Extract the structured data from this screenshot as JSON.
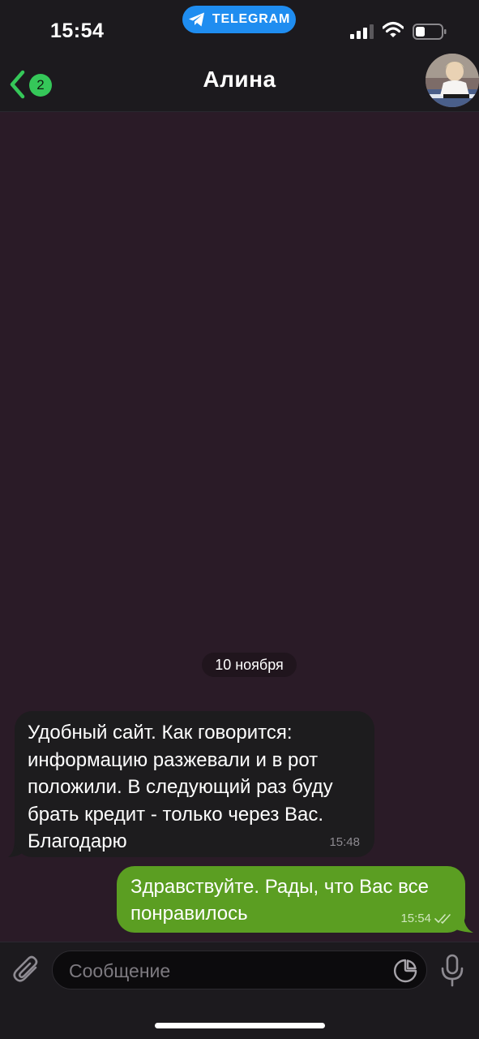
{
  "status_bar": {
    "time": "15:54",
    "app_label": "TELEGRAM",
    "app_color": "#1f8df0"
  },
  "header": {
    "back_icon": "chevron-left-icon",
    "unread_count": "2",
    "title": "Алина",
    "avatar": "contact-avatar"
  },
  "chat": {
    "background": "#2a1b27",
    "date_separator": "10 ноября",
    "messages": [
      {
        "direction": "incoming",
        "lines": [
          "Удобный сайт. Как говорится:",
          "информацию разжевали и в рот",
          "положили. В следующий раз буду",
          "брать кредит - только через Вас.",
          "Благодарю"
        ],
        "time": "15:48"
      },
      {
        "direction": "outgoing",
        "lines": [
          "Здравствуйте. Рады, что Вас все",
          "понравилось"
        ],
        "time": "15:54",
        "status_icon": "double-check-icon"
      }
    ]
  },
  "input_bar": {
    "placeholder": "Сообщение",
    "attach_icon": "paperclip-icon",
    "sticker_icon": "sticker-icon",
    "mic_icon": "microphone-icon"
  },
  "colors": {
    "accent_green": "#35c759",
    "outgoing_bubble": "#5b9e22",
    "incoming_bubble": "#1d1c1e"
  }
}
